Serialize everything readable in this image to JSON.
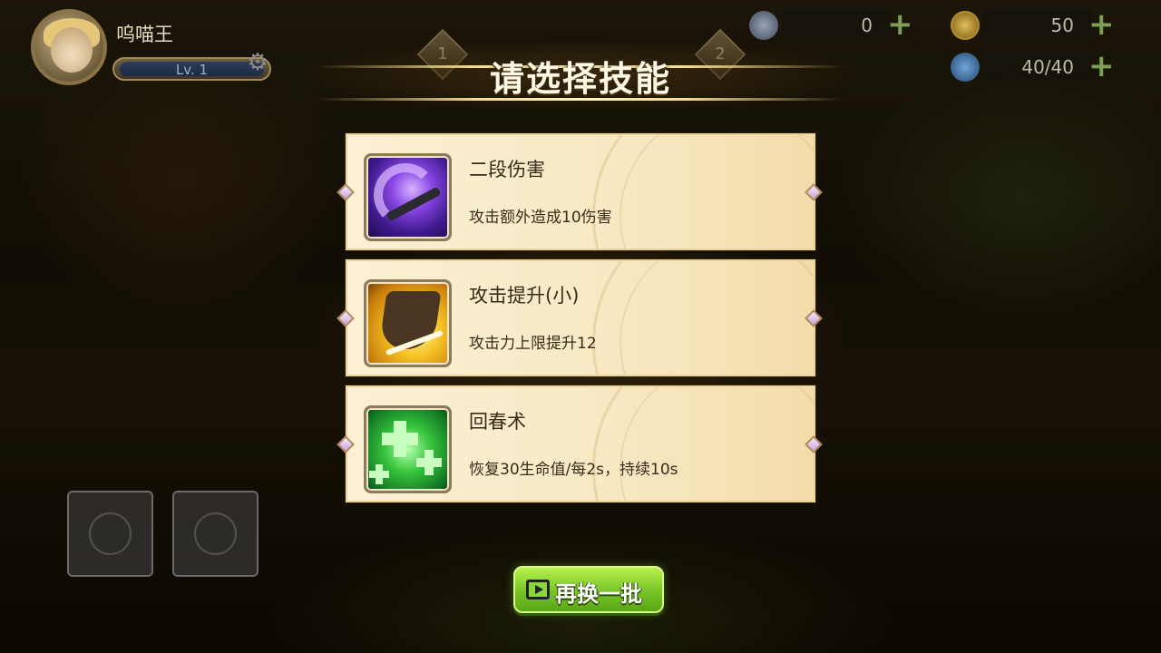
{
  "player": {
    "name": "呜喵王",
    "level": "Lv. 1"
  },
  "resources": [
    {
      "icon": "helmet-icon",
      "value": "0"
    },
    {
      "icon": "coin-icon",
      "value": "50"
    },
    {
      "icon": "stamina-icon",
      "value": "40/40"
    }
  ],
  "steps": [
    "1",
    "2"
  ],
  "title": "请选择技能",
  "skills": [
    {
      "name": "二段伤害",
      "desc": "攻击额外造成10伤害",
      "icon": "purple-slash-icon"
    },
    {
      "name": "攻击提升(小)",
      "desc": "攻击力上限提升12",
      "icon": "yellow-hat-icon"
    },
    {
      "name": "回春术",
      "desc": "恢复30生命值/每2s，持续10s",
      "icon": "green-cross-icon"
    }
  ],
  "refresh_label": "再换一批",
  "colors": {
    "card_bg": "#f8e9c4",
    "text_dark": "#3b2a1a",
    "button_green": "#7cc82a"
  }
}
